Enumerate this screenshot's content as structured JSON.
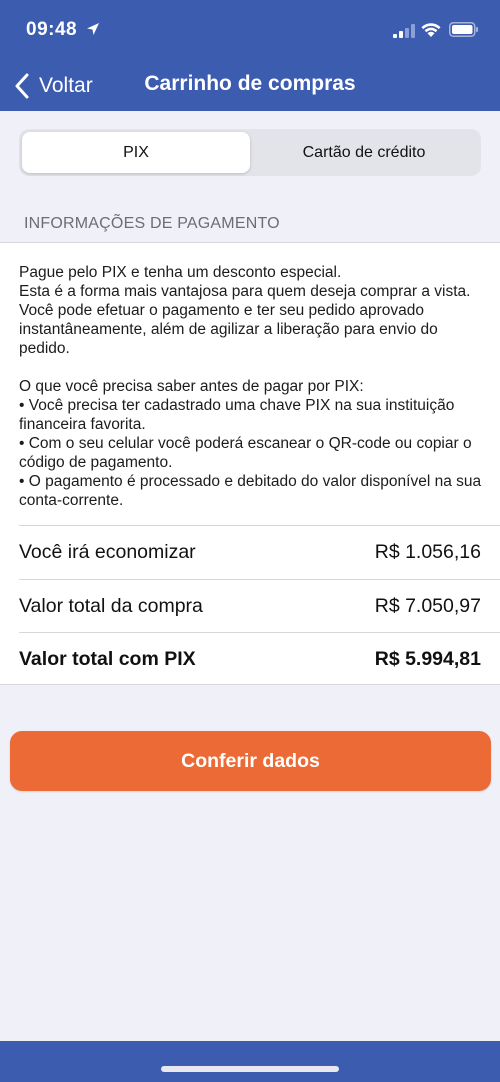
{
  "status_bar": {
    "time": "09:48",
    "icons": [
      "location-arrow-icon",
      "signal-icon",
      "wifi-icon",
      "battery-icon"
    ]
  },
  "nav": {
    "back_label": "Voltar",
    "title": "Carrinho de compras"
  },
  "payment_tabs": {
    "selected": "PIX",
    "items": [
      {
        "label": "PIX"
      },
      {
        "label": "Cartão de crédito"
      }
    ]
  },
  "section_label": "INFORMAÇÕES DE PAGAMENTO",
  "info": {
    "paragraph1": "Pague pelo PIX e tenha um desconto especial.\nEsta é a forma mais vantajosa para quem deseja comprar a vista. Você pode efetuar o pagamento e ter seu pedido aprovado instantâneamente, além de agilizar a liberação para envio do pedido.",
    "paragraph2": "O que você precisa saber antes de pagar por PIX:\n• Você precisa ter cadastrado uma chave PIX na sua instituição financeira favorita.\n• Com o seu celular você poderá escanear o QR-code ou copiar o código de pagamento.\n• O pagamento é processado e debitado do valor disponível na sua conta-corrente."
  },
  "summary": [
    {
      "label": "Você irá economizar",
      "value": "R$ 1.056,16"
    },
    {
      "label": "Valor total da compra",
      "value": "R$ 7.050,97"
    },
    {
      "label": "Valor total com PIX",
      "value": "R$ 5.994,81"
    }
  ],
  "cta_label": "Conferir dados",
  "colors": {
    "header": "#3c5cb0",
    "cta": "#ec6a35",
    "background": "#eff0f8"
  }
}
